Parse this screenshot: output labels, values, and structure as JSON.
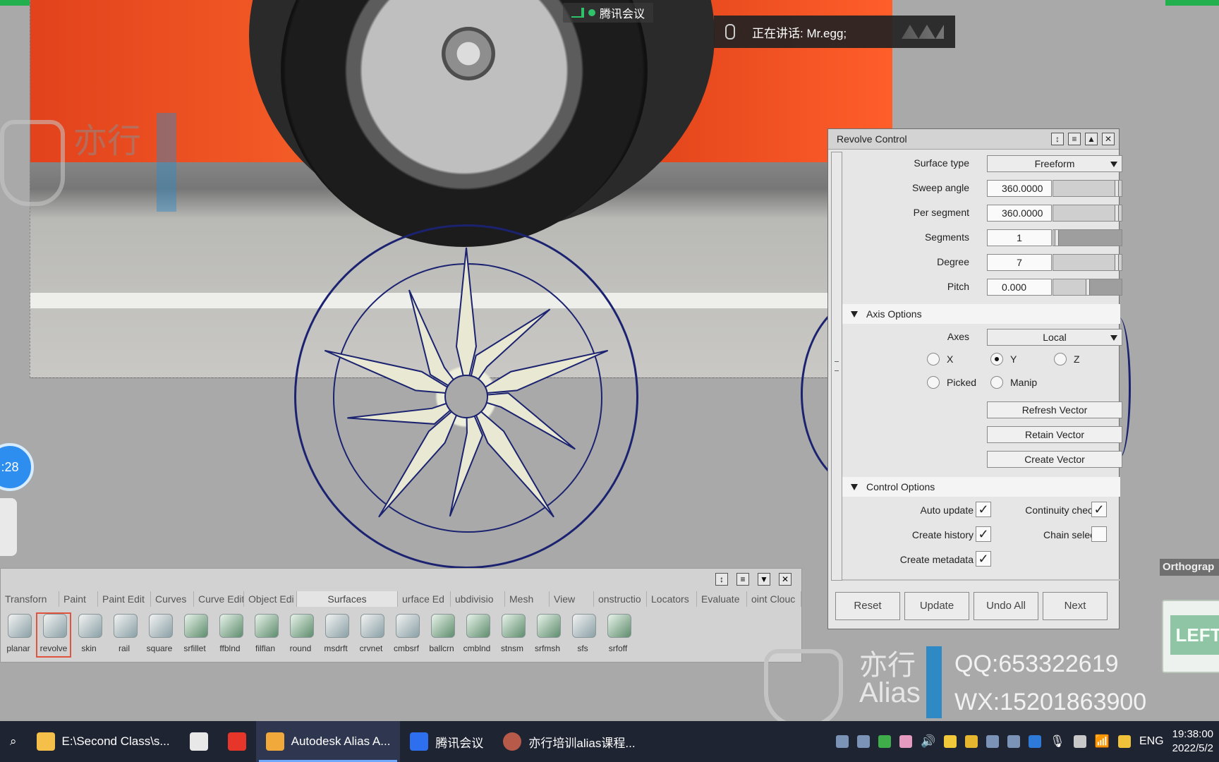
{
  "meeting": {
    "app_tag": "腾讯会议",
    "speaking": "正在讲话: Mr.egg;"
  },
  "timer_text": ":28",
  "watermark": {
    "cn": "亦行",
    "en": "Alias",
    "qq": "QQ:653322619",
    "wx": "WX:15201863900"
  },
  "revolve": {
    "title": "Revolve Control",
    "fields": {
      "surface_type": {
        "label": "Surface type",
        "value": "Freeform"
      },
      "sweep_angle": {
        "label": "Sweep angle",
        "value": "360.0000"
      },
      "per_segment": {
        "label": "Per segment",
        "value": "360.0000"
      },
      "segments": {
        "label": "Segments",
        "value": "1"
      },
      "degree": {
        "label": "Degree",
        "value": "7"
      },
      "pitch": {
        "label": "Pitch",
        "value": "0.000"
      }
    },
    "axis_options": {
      "header": "Axis Options",
      "axes_label": "Axes",
      "axes_value": "Local",
      "radio_x": "X",
      "radio_y": "Y",
      "radio_z": "Z",
      "radio_picked": "Picked",
      "radio_manip": "Manip",
      "selected": "Y",
      "refresh": "Refresh Vector",
      "retain": "Retain Vector",
      "create": "Create Vector"
    },
    "control_options": {
      "header": "Control Options",
      "auto_update": "Auto update",
      "continuity_check": "Continuity check",
      "create_history": "Create history",
      "chain_select": "Chain select",
      "create_metadata": "Create metadata"
    },
    "footer": {
      "reset": "Reset",
      "update": "Update",
      "undo_all": "Undo All",
      "next": "Next"
    }
  },
  "shelf": {
    "tabs": [
      "Transform",
      "Paint",
      "Paint Edit",
      "Curves",
      "Curve Edit",
      "Object Edit",
      "Surfaces",
      "Surface Edit",
      "Subdivision",
      "Mesh",
      "View",
      "Construction",
      "Locators",
      "Evaluate",
      "Point Cloud"
    ],
    "tabs_visible": [
      "Transforn",
      "Paint",
      "Paint Edit",
      "Curves",
      "Curve Edit",
      "Object Edi",
      "Surfaces",
      "urface Ed",
      "ubdivisio",
      "Mesh",
      "View",
      "onstructio",
      "Locators",
      "Evaluate",
      "oint Clouc"
    ],
    "active_tab": "Surfaces",
    "tools": [
      "planar",
      "revolve",
      "skin",
      "rail",
      "square",
      "srfillet",
      "ffblnd",
      "filflan",
      "round",
      "msdrft",
      "crvnet",
      "cmbsrf",
      "ballcrn",
      "cmblnd",
      "stnsm",
      "srfmsh",
      "sfs",
      "srfoff"
    ],
    "selected_tool": "revolve"
  },
  "view_labels": {
    "orthographic": "Orthograp",
    "view_cube": "LEFT"
  },
  "taskbar": {
    "items": [
      {
        "label": "E:\\Second Class\\s..."
      },
      {
        "label": ""
      },
      {
        "label": ""
      },
      {
        "label": "Autodesk Alias A..."
      },
      {
        "label": "腾讯会议"
      },
      {
        "label": "亦行培训alias课程..."
      }
    ],
    "ime": "ENG",
    "time": "19:38:00",
    "date": "2022/5/2"
  },
  "colors": {
    "accent_blue": "#2e89c5",
    "selection_red": "#e0533d",
    "meeting_green": "#2fc26a",
    "taskbar_bg": "#1f2433"
  }
}
